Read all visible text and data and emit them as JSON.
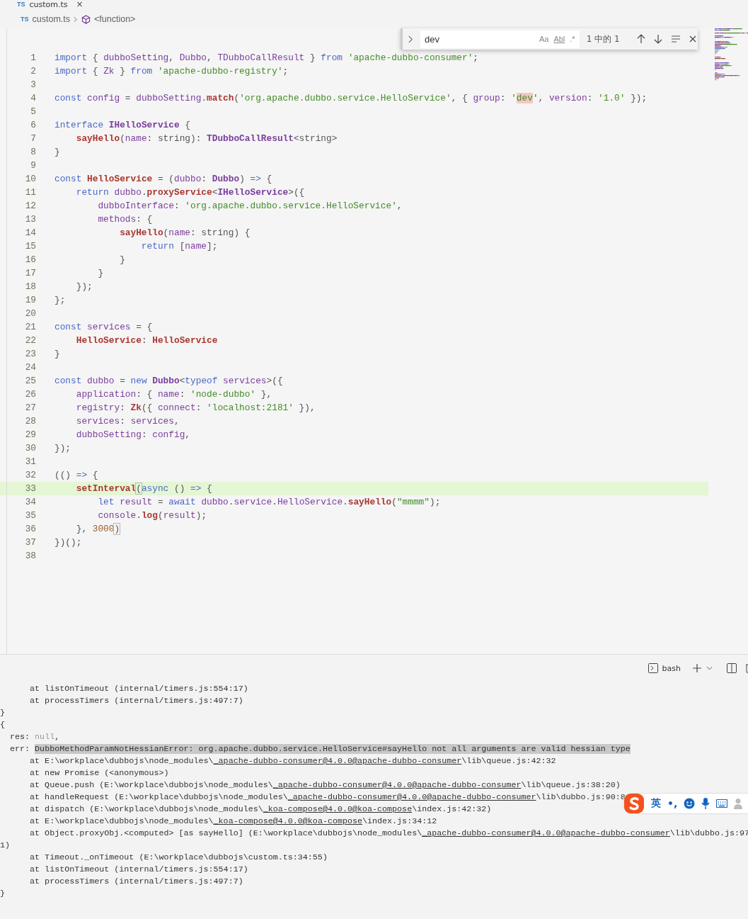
{
  "tab": {
    "icon_label": "TS",
    "label": "custom.ts",
    "close": "×"
  },
  "breadcrumb": {
    "icon_label": "TS",
    "file": "custom.ts",
    "symbol": "<function>"
  },
  "find_widget": {
    "value": "dev",
    "match_count": "1 中的 1",
    "options": [
      {
        "label": "Aa",
        "on": false
      },
      {
        "label": "Abl",
        "on": false
      },
      {
        "label": ".*",
        "on": false
      }
    ]
  },
  "editor": {
    "lines": [
      {
        "number": "1",
        "current": false,
        "tokens": [
          {
            "kind": "keyword",
            "text": "import"
          },
          {
            "kind": "punct",
            "text": " { "
          },
          {
            "kind": "variable",
            "text": "dubboSetting"
          },
          {
            "kind": "punct",
            "text": ", "
          },
          {
            "kind": "variable",
            "text": "Dubbo"
          },
          {
            "kind": "punct",
            "text": ", "
          },
          {
            "kind": "variable",
            "text": "TDubboCallResult"
          },
          {
            "kind": "punct",
            "text": " } "
          },
          {
            "kind": "keyword",
            "text": "from"
          },
          {
            "kind": "string",
            "text": " 'apache-dubbo-consumer'"
          },
          {
            "kind": "punct",
            "text": ";"
          }
        ]
      },
      {
        "number": "2",
        "current": false,
        "tokens": [
          {
            "kind": "keyword",
            "text": "import"
          },
          {
            "kind": "punct",
            "text": " { "
          },
          {
            "kind": "variable",
            "text": "Zk"
          },
          {
            "kind": "punct",
            "text": " } "
          },
          {
            "kind": "keyword",
            "text": "from"
          },
          {
            "kind": "string",
            "text": " 'apache-dubbo-registry'"
          },
          {
            "kind": "punct",
            "text": ";"
          }
        ]
      },
      {
        "number": "3",
        "current": false
      },
      {
        "number": "4",
        "current": false,
        "tokens": [
          {
            "kind": "keyword",
            "text": "const"
          },
          {
            "kind": "variable",
            "text": " config"
          },
          {
            "kind": "punct",
            "text": " = "
          },
          {
            "kind": "variable",
            "text": "dubboSetting"
          },
          {
            "kind": "punct",
            "text": "."
          },
          {
            "kind": "function",
            "text": "match"
          },
          {
            "kind": "punct",
            "text": "("
          },
          {
            "kind": "string",
            "text": "'org.apache.dubbo.service.HelloService'"
          },
          {
            "kind": "punct",
            "text": ", { "
          },
          {
            "kind": "variable",
            "text": "group"
          },
          {
            "kind": "punct",
            "text": ": "
          },
          {
            "kind": "string",
            "text": "'"
          },
          {
            "kind": "match",
            "text": "dev"
          },
          {
            "kind": "string",
            "text": "'"
          },
          {
            "kind": "punct",
            "text": ", "
          },
          {
            "kind": "variable",
            "text": "version"
          },
          {
            "kind": "punct",
            "text": ": "
          },
          {
            "kind": "string",
            "text": "'1.0'"
          },
          {
            "kind": "punct",
            "text": " });"
          }
        ]
      },
      {
        "number": "5",
        "current": false
      },
      {
        "number": "6",
        "current": false,
        "tokens": [
          {
            "kind": "keyword",
            "text": "interface"
          },
          {
            "kind": "type",
            "text": " IHelloService"
          },
          {
            "kind": "punct",
            "text": " {"
          }
        ]
      },
      {
        "number": "7",
        "current": false,
        "tokens": [
          {
            "kind": "function",
            "text": "    sayHello"
          },
          {
            "kind": "punct",
            "text": "("
          },
          {
            "kind": "variable",
            "text": "name"
          },
          {
            "kind": "punct",
            "text": ": string): "
          },
          {
            "kind": "type",
            "text": "TDubboCallResult"
          },
          {
            "kind": "punct",
            "text": "<string>"
          }
        ]
      },
      {
        "number": "8",
        "current": false,
        "tokens": [
          {
            "kind": "punct",
            "text": "}"
          }
        ]
      },
      {
        "number": "9",
        "current": false
      },
      {
        "number": "10",
        "current": false,
        "tokens": [
          {
            "kind": "keyword",
            "text": "const"
          },
          {
            "kind": "function",
            "text": " HelloService"
          },
          {
            "kind": "punct",
            "text": " = ("
          },
          {
            "kind": "variable",
            "text": "dubbo"
          },
          {
            "kind": "punct",
            "text": ": "
          },
          {
            "kind": "type",
            "text": "Dubbo"
          },
          {
            "kind": "punct",
            "text": ") "
          },
          {
            "kind": "keyword",
            "text": "=>"
          },
          {
            "kind": "punct",
            "text": " {"
          }
        ]
      },
      {
        "number": "11",
        "current": false,
        "tokens": [
          {
            "kind": "keyword",
            "text": "    return"
          },
          {
            "kind": "variable",
            "text": " dubbo"
          },
          {
            "kind": "punct",
            "text": "."
          },
          {
            "kind": "function",
            "text": "proxyService"
          },
          {
            "kind": "punct",
            "text": "<"
          },
          {
            "kind": "type",
            "text": "IHelloService"
          },
          {
            "kind": "punct",
            "text": ">({"
          }
        ]
      },
      {
        "number": "12",
        "current": false,
        "tokens": [
          {
            "kind": "variable",
            "text": "        dubboInterface"
          },
          {
            "kind": "punct",
            "text": ": "
          },
          {
            "kind": "string",
            "text": "'org.apache.dubbo.service.HelloService'"
          },
          {
            "kind": "punct",
            "text": ","
          }
        ]
      },
      {
        "number": "13",
        "current": false,
        "tokens": [
          {
            "kind": "variable",
            "text": "        methods"
          },
          {
            "kind": "punct",
            "text": ": {"
          }
        ]
      },
      {
        "number": "14",
        "current": false,
        "tokens": [
          {
            "kind": "function",
            "text": "            sayHello"
          },
          {
            "kind": "punct",
            "text": "("
          },
          {
            "kind": "variable",
            "text": "name"
          },
          {
            "kind": "punct",
            "text": ": string) {"
          }
        ]
      },
      {
        "number": "15",
        "current": false,
        "tokens": [
          {
            "kind": "keyword",
            "text": "                return"
          },
          {
            "kind": "punct",
            "text": " ["
          },
          {
            "kind": "variable",
            "text": "name"
          },
          {
            "kind": "punct",
            "text": "];"
          }
        ]
      },
      {
        "number": "16",
        "current": false,
        "tokens": [
          {
            "kind": "punct",
            "text": "            }"
          }
        ]
      },
      {
        "number": "17",
        "current": false,
        "tokens": [
          {
            "kind": "punct",
            "text": "        }"
          }
        ]
      },
      {
        "number": "18",
        "current": false,
        "tokens": [
          {
            "kind": "punct",
            "text": "    });"
          }
        ]
      },
      {
        "number": "19",
        "current": false,
        "tokens": [
          {
            "kind": "punct",
            "text": "};"
          }
        ]
      },
      {
        "number": "20",
        "current": false
      },
      {
        "number": "21",
        "current": false,
        "tokens": [
          {
            "kind": "keyword",
            "text": "const"
          },
          {
            "kind": "variable",
            "text": " services"
          },
          {
            "kind": "punct",
            "text": " = {"
          }
        ]
      },
      {
        "number": "22",
        "current": false,
        "tokens": [
          {
            "kind": "function",
            "text": "    HelloService"
          },
          {
            "kind": "punct",
            "text": ": "
          },
          {
            "kind": "function",
            "text": "HelloService"
          }
        ]
      },
      {
        "number": "23",
        "current": false,
        "tokens": [
          {
            "kind": "punct",
            "text": "}"
          }
        ]
      },
      {
        "number": "24",
        "current": false
      },
      {
        "number": "25",
        "current": false,
        "tokens": [
          {
            "kind": "keyword",
            "text": "const"
          },
          {
            "kind": "variable",
            "text": " dubbo"
          },
          {
            "kind": "punct",
            "text": " = "
          },
          {
            "kind": "keyword",
            "text": "new"
          },
          {
            "kind": "type",
            "text": " Dubbo"
          },
          {
            "kind": "punct",
            "text": "<"
          },
          {
            "kind": "keyword",
            "text": "typeof"
          },
          {
            "kind": "variable",
            "text": " services"
          },
          {
            "kind": "punct",
            "text": ">({"
          }
        ]
      },
      {
        "number": "26",
        "current": false,
        "tokens": [
          {
            "kind": "variable",
            "text": "    application"
          },
          {
            "kind": "punct",
            "text": ": { "
          },
          {
            "kind": "variable",
            "text": "name"
          },
          {
            "kind": "punct",
            "text": ": "
          },
          {
            "kind": "string",
            "text": "'node-dubbo'"
          },
          {
            "kind": "punct",
            "text": " },"
          }
        ]
      },
      {
        "number": "27",
        "current": false,
        "tokens": [
          {
            "kind": "variable",
            "text": "    registry"
          },
          {
            "kind": "punct",
            "text": ": "
          },
          {
            "kind": "function",
            "text": "Zk"
          },
          {
            "kind": "punct",
            "text": "({ "
          },
          {
            "kind": "variable",
            "text": "connect"
          },
          {
            "kind": "punct",
            "text": ": "
          },
          {
            "kind": "string",
            "text": "'localhost:2181'"
          },
          {
            "kind": "punct",
            "text": " }),"
          }
        ]
      },
      {
        "number": "28",
        "current": false,
        "tokens": [
          {
            "kind": "variable",
            "text": "    services"
          },
          {
            "kind": "punct",
            "text": ": "
          },
          {
            "kind": "variable",
            "text": "services"
          },
          {
            "kind": "punct",
            "text": ","
          }
        ]
      },
      {
        "number": "29",
        "current": false,
        "tokens": [
          {
            "kind": "variable",
            "text": "    dubboSetting"
          },
          {
            "kind": "punct",
            "text": ": "
          },
          {
            "kind": "variable",
            "text": "config"
          },
          {
            "kind": "punct",
            "text": ","
          }
        ]
      },
      {
        "number": "30",
        "current": false,
        "tokens": [
          {
            "kind": "punct",
            "text": "});"
          }
        ]
      },
      {
        "number": "31",
        "current": false
      },
      {
        "number": "32",
        "current": false,
        "tokens": [
          {
            "kind": "punct",
            "text": "(() "
          },
          {
            "kind": "keyword",
            "text": "=>"
          },
          {
            "kind": "punct",
            "text": " {"
          }
        ]
      },
      {
        "number": "33",
        "current": true,
        "tokens": [
          {
            "kind": "function",
            "text": "    setInterval"
          },
          {
            "kind": "bracket",
            "text": "("
          },
          {
            "kind": "keyword",
            "text": "async"
          },
          {
            "kind": "punct",
            "text": " () "
          },
          {
            "kind": "keyword",
            "text": "=>"
          },
          {
            "kind": "punct",
            "text": " {"
          }
        ]
      },
      {
        "number": "34",
        "current": false,
        "tokens": [
          {
            "kind": "keyword",
            "text": "        let"
          },
          {
            "kind": "variable",
            "text": " result"
          },
          {
            "kind": "punct",
            "text": " = "
          },
          {
            "kind": "keyword",
            "text": "await"
          },
          {
            "kind": "variable",
            "text": " dubbo"
          },
          {
            "kind": "punct",
            "text": "."
          },
          {
            "kind": "variable",
            "text": "service"
          },
          {
            "kind": "punct",
            "text": "."
          },
          {
            "kind": "variable",
            "text": "HelloService"
          },
          {
            "kind": "punct",
            "text": "."
          },
          {
            "kind": "function",
            "text": "sayHello"
          },
          {
            "kind": "punct",
            "text": "("
          },
          {
            "kind": "string",
            "text": "\"mmmm\""
          },
          {
            "kind": "punct",
            "text": ");"
          }
        ]
      },
      {
        "number": "35",
        "current": false,
        "tokens": [
          {
            "kind": "variable",
            "text": "        console"
          },
          {
            "kind": "punct",
            "text": "."
          },
          {
            "kind": "function",
            "text": "log"
          },
          {
            "kind": "punct",
            "text": "("
          },
          {
            "kind": "variable",
            "text": "result"
          },
          {
            "kind": "punct",
            "text": ");"
          }
        ]
      },
      {
        "number": "36",
        "current": false,
        "tokens": [
          {
            "kind": "punct",
            "text": "    }, "
          },
          {
            "kind": "number",
            "text": "3000"
          },
          {
            "kind": "bracket",
            "text": ")"
          }
        ]
      },
      {
        "number": "37",
        "current": false,
        "tokens": [
          {
            "kind": "punct",
            "text": "})();"
          }
        ]
      },
      {
        "number": "38",
        "current": false
      }
    ]
  },
  "terminal": {
    "shell": "bash",
    "lines": [
      [
        {
          "kind": "plain",
          "text": "      at listOnTimeout (internal/timers.js:554:17)"
        }
      ],
      [
        {
          "kind": "plain",
          "text": "      at processTimers (internal/timers.js:497:7)"
        }
      ],
      [
        {
          "kind": "plain",
          "text": "}"
        }
      ],
      [
        {
          "kind": "plain",
          "text": "{"
        }
      ],
      [
        {
          "kind": "plain",
          "text": "  res: "
        },
        {
          "kind": "dim",
          "text": "null"
        },
        {
          "kind": "plain",
          "text": ","
        }
      ],
      [
        {
          "kind": "plain",
          "text": "  err: "
        },
        {
          "kind": "selection",
          "text": "DubboMethodParamNotHessianError: org.apache.dubbo.service.HelloService#sayHello not all arguments are valid hessian type"
        }
      ],
      [
        {
          "kind": "plain",
          "text": "      at E:\\workplace\\dubbojs\\node_modules\\"
        },
        {
          "kind": "link",
          "text": "_apache-dubbo-consumer@4.0.0@apache-dubbo-consumer"
        },
        {
          "kind": "plain",
          "text": "\\lib\\queue.js:42:32"
        }
      ],
      [
        {
          "kind": "plain",
          "text": "      at new Promise (<anonymous>)"
        }
      ],
      [
        {
          "kind": "plain",
          "text": "      at Queue.push (E:\\workplace\\dubbojs\\node_modules\\"
        },
        {
          "kind": "link",
          "text": "_apache-dubbo-consumer@4.0.0@apache-dubbo-consumer"
        },
        {
          "kind": "plain",
          "text": "\\lib\\queue.js:38:20)"
        }
      ],
      [
        {
          "kind": "plain",
          "text": "      at handleRequest (E:\\workplace\\dubbojs\\node_modules\\"
        },
        {
          "kind": "link",
          "text": "_apache-dubbo-consumer@4.0.0@apache-dubbo-consumer"
        },
        {
          "kind": "plain",
          "text": "\\lib\\dubbo.js:90:8"
        }
      ],
      [
        {
          "kind": "plain",
          "text": "      at dispatch (E:\\workplace\\dubbojs\\node_modules\\"
        },
        {
          "kind": "link",
          "text": "_koa-compose@4.0.0@koa-compose"
        },
        {
          "kind": "plain",
          "text": "\\index.js:42:32)"
        }
      ],
      [
        {
          "kind": "plain",
          "text": "      at E:\\workplace\\dubbojs\\node_modules\\"
        },
        {
          "kind": "link",
          "text": "_koa-compose@4.0.0@koa-compose"
        },
        {
          "kind": "plain",
          "text": "\\index.js:34:12"
        }
      ],
      [
        {
          "kind": "plain",
          "text": "      at Object.proxyObj.<computed> [as sayHello] (E:\\workplace\\dubbojs\\node_modules\\"
        },
        {
          "kind": "link",
          "text": "_apache-dubbo-consumer@4.0.0@apache-dubbo-consumer"
        },
        {
          "kind": "plain",
          "text": "\\lib\\dubbo.js:97"
        }
      ],
      [
        {
          "kind": "plain",
          "text": "1)"
        }
      ],
      [
        {
          "kind": "plain",
          "text": "      at Timeout._onTimeout (E:\\workplace\\dubbojs\\custom.ts:34:55)"
        }
      ],
      [
        {
          "kind": "plain",
          "text": "      at listOnTimeout (internal/timers.js:554:17)"
        }
      ],
      [
        {
          "kind": "plain",
          "text": "      at processTimers (internal/timers.js:497:7)"
        }
      ],
      [
        {
          "kind": "plain",
          "text": "}"
        }
      ]
    ]
  },
  "ime_toolbar": {
    "language": "英",
    "punctuation": "•,"
  }
}
